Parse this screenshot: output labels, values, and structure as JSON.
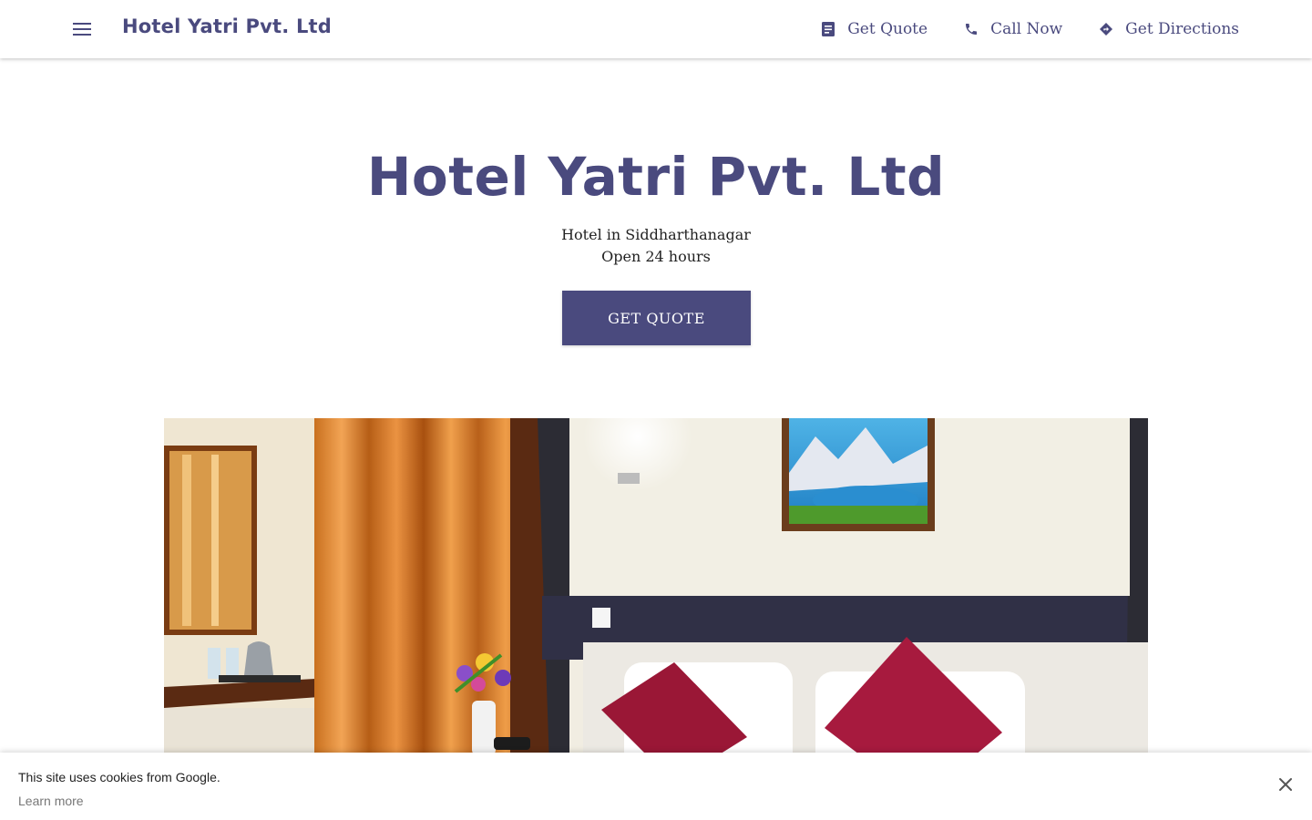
{
  "header": {
    "brand": "Hotel Yatri Pvt. Ltd",
    "menu_icon": "menu-icon",
    "nav": [
      {
        "label": "Get Quote",
        "icon": "quote-icon"
      },
      {
        "label": "Call Now",
        "icon": "phone-icon"
      },
      {
        "label": "Get Directions",
        "icon": "directions-icon"
      }
    ]
  },
  "hero": {
    "title": "Hotel Yatri Pvt. Ltd",
    "category": "Hotel in Siddharthanagar",
    "hours": "Open 24 hours",
    "cta_label": "GET QUOTE"
  },
  "cookie_banner": {
    "message": "This site uses cookies from Google.",
    "link": "Learn more",
    "close_icon": "close-icon"
  },
  "colors": {
    "primary": "#4a4a7e",
    "background": "#ffffff"
  }
}
